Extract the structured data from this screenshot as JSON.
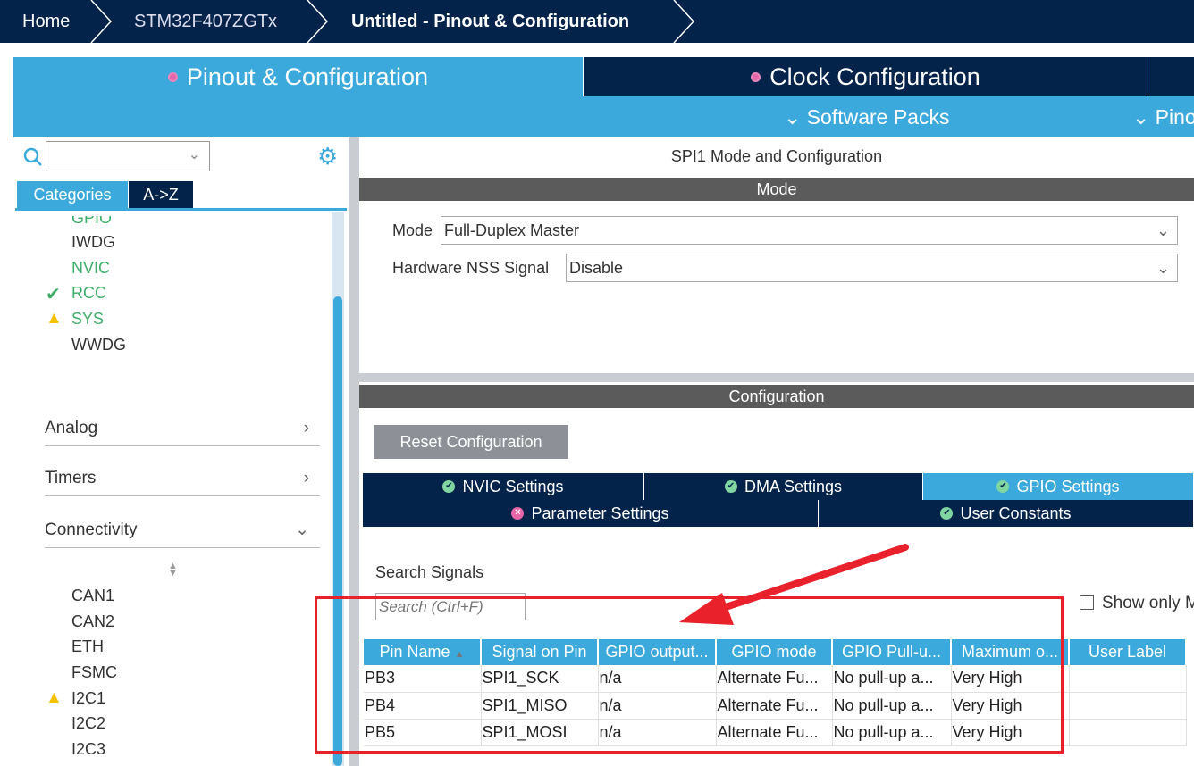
{
  "breadcrumb": [
    "Home",
    "STM32F407ZGTx",
    "Untitled - Pinout & Configuration"
  ],
  "tabs": {
    "pinout": "Pinout & Configuration",
    "clock": "Clock Configuration"
  },
  "subbar": {
    "software_packs": "Software Packs",
    "pinout": "Pino"
  },
  "sidebar": {
    "search_value": "",
    "view_tabs": [
      "Categories",
      "A->Z"
    ],
    "system_items": [
      {
        "label": "GPIO",
        "status": "configured"
      },
      {
        "label": "IWDG",
        "status": "none"
      },
      {
        "label": "NVIC",
        "status": "configured"
      },
      {
        "label": "RCC",
        "status": "ok"
      },
      {
        "label": "SYS",
        "status": "warning"
      },
      {
        "label": "WWDG",
        "status": "none"
      }
    ],
    "categories": [
      "Analog",
      "Timers",
      "Connectivity"
    ],
    "connectivity_items": [
      {
        "label": "CAN1",
        "status": "none"
      },
      {
        "label": "CAN2",
        "status": "none"
      },
      {
        "label": "ETH",
        "status": "none"
      },
      {
        "label": "FSMC",
        "status": "none"
      },
      {
        "label": "I2C1",
        "status": "warning"
      },
      {
        "label": "I2C2",
        "status": "none"
      },
      {
        "label": "I2C3",
        "status": "none"
      }
    ]
  },
  "main": {
    "title": "SPI1 Mode and Configuration",
    "mode_header": "Mode",
    "mode_label": "Mode",
    "mode_value": "Full-Duplex Master",
    "nss_label": "Hardware NSS Signal",
    "nss_value": "Disable",
    "config_header": "Configuration",
    "reset_button": "Reset Configuration",
    "settings_tabs": [
      "NVIC Settings",
      "DMA Settings",
      "GPIO Settings",
      "Parameter Settings",
      "User Constants"
    ],
    "search_label": "Search Signals",
    "search_placeholder": "Search (Ctrl+F)",
    "show_only": "Show only M",
    "columns": [
      "Pin Name",
      "Signal on Pin",
      "GPIO output...",
      "GPIO mode",
      "GPIO Pull-u...",
      "Maximum o...",
      "User Label"
    ],
    "rows": [
      [
        "PB3",
        "SPI1_SCK",
        "n/a",
        "Alternate Fu...",
        "No pull-up a...",
        "Very High",
        ""
      ],
      [
        "PB4",
        "SPI1_MISO",
        "n/a",
        "Alternate Fu...",
        "No pull-up a...",
        "Very High",
        ""
      ],
      [
        "PB5",
        "SPI1_MOSI",
        "n/a",
        "Alternate Fu...",
        "No pull-up a...",
        "Very High",
        ""
      ]
    ]
  },
  "colors": {
    "navy": "#03234b",
    "blue": "#3ba9dc",
    "annotation_red": "#e8212b"
  }
}
